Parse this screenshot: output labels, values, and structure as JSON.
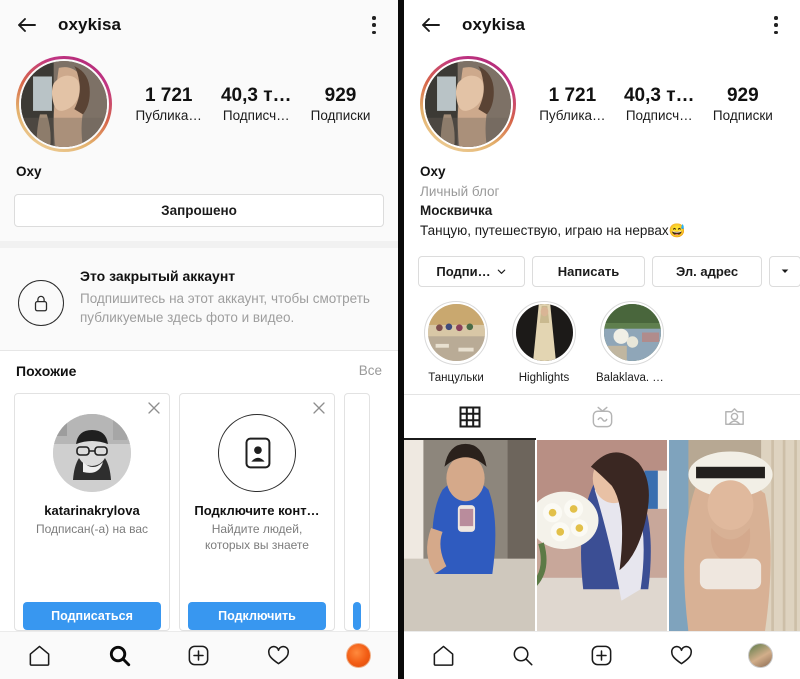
{
  "left_panel": {
    "header": {
      "back_icon": "arrow-left-icon",
      "title": "oxykisa",
      "menu_icon": "kebab-menu-icon"
    },
    "profile": {
      "avatar_alt": "profile-avatar",
      "stats": [
        {
          "value": "1 721",
          "label": "Публика…"
        },
        {
          "value": "40,3 т…",
          "label": "Подписч…"
        },
        {
          "value": "929",
          "label": "Подписки"
        }
      ],
      "display_name": "Oxy"
    },
    "primary_button": "Запрошено",
    "private_notice": {
      "icon": "lock-icon",
      "title": "Это закрытый аккаунт",
      "body": "Подпишитесь на этот аккаунт, чтобы смотреть публикуемые здесь фото и видео."
    },
    "similar": {
      "title": "Похожие",
      "see_all": "Все",
      "cards": [
        {
          "avatar": "user-photo-avatar",
          "name": "katarinakrylova",
          "subtitle": "Подписан(-а) на вас",
          "button": "Подписаться",
          "close_icon": "close-icon"
        },
        {
          "avatar": "contacts-icon",
          "name": "Подключите конт…",
          "subtitle": "Найдите людей, которых вы знаете",
          "button": "Подключить",
          "close_icon": "close-icon"
        }
      ]
    },
    "bottom_nav": [
      {
        "icon": "home-icon",
        "active": false
      },
      {
        "icon": "search-icon",
        "active": true
      },
      {
        "icon": "add-post-icon",
        "active": false
      },
      {
        "icon": "heart-icon",
        "active": false
      },
      {
        "icon": "profile-avatar-icon",
        "active": false
      }
    ]
  },
  "right_panel": {
    "header": {
      "back_icon": "arrow-left-icon",
      "title": "oxykisa",
      "menu_icon": "kebab-menu-icon"
    },
    "profile": {
      "avatar_alt": "profile-avatar",
      "stats": [
        {
          "value": "1 721",
          "label": "Публика…"
        },
        {
          "value": "40,3 т…",
          "label": "Подписч…"
        },
        {
          "value": "929",
          "label": "Подписки"
        }
      ],
      "display_name": "Oxy",
      "category": "Личный блог",
      "bio_lines": [
        "Москвичка",
        "Танцую, путешествую, играю на нервах😅"
      ]
    },
    "actions": {
      "follow_label": "Подпи…",
      "follow_chevron": "chevron-down-icon",
      "message_label": "Написать",
      "email_label": "Эл. адрес",
      "more_icon": "caret-down-icon"
    },
    "highlights": [
      {
        "label": "Танцульки",
        "cover": "dance-cover"
      },
      {
        "label": "Highlights",
        "cover": "dress-cover"
      },
      {
        "label": "Balaklava. Cr…",
        "cover": "balaklava-cover"
      }
    ],
    "tabs": [
      {
        "icon": "grid-icon",
        "active": true
      },
      {
        "icon": "igtv-icon",
        "active": false
      },
      {
        "icon": "tagged-icon",
        "active": false
      }
    ],
    "photos": [
      {
        "alt": "mirror-selfie-photo"
      },
      {
        "alt": "daisies-bouquet-photo"
      },
      {
        "alt": "hat-portrait-photo"
      }
    ],
    "bottom_nav": [
      {
        "icon": "home-icon",
        "active": false
      },
      {
        "icon": "search-icon",
        "active": false
      },
      {
        "icon": "add-post-icon",
        "active": false
      },
      {
        "icon": "heart-icon",
        "active": false
      },
      {
        "icon": "profile-avatar-icon",
        "active": false
      }
    ]
  },
  "colors": {
    "accent_blue": "#3897f0",
    "bg_gray": "#fafafa",
    "muted_text": "#9a9a9a",
    "divider": "#0a0a0a"
  }
}
